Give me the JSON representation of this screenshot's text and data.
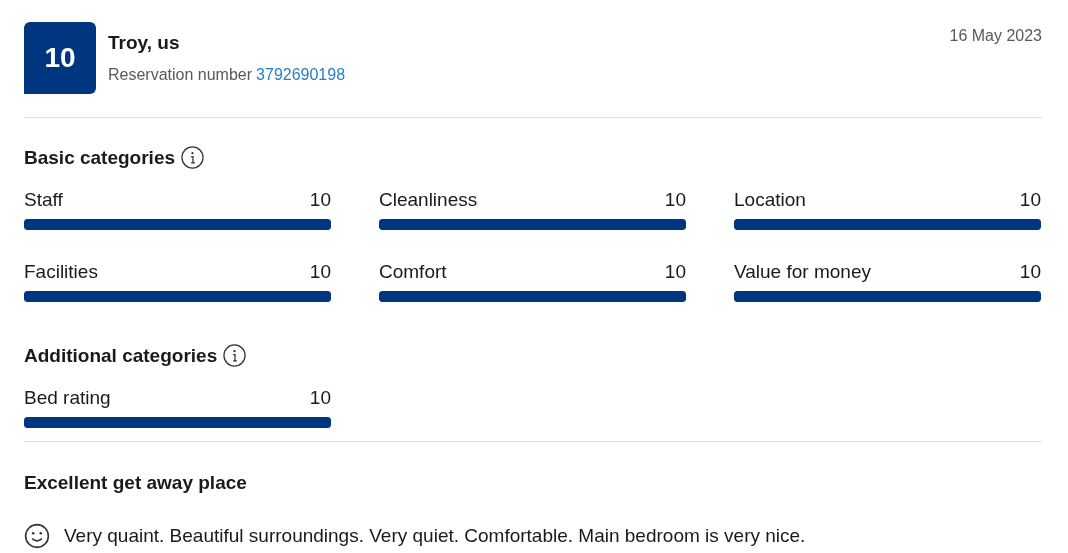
{
  "score": "10",
  "reviewer": {
    "name": "Troy, us",
    "reservation_label": "Reservation number",
    "reservation_number": "3792690198"
  },
  "date": "16 May 2023",
  "sections": [
    {
      "title": "Basic categories",
      "categories": [
        {
          "label": "Staff",
          "score": "10",
          "level": 1
        },
        {
          "label": "Cleanliness",
          "score": "10",
          "level": 1
        },
        {
          "label": "Location",
          "score": "10",
          "level": 1
        },
        {
          "label": "Facilities",
          "score": "10",
          "level": 1
        },
        {
          "label": "Comfort",
          "score": "10",
          "level": 1
        },
        {
          "label": "Value for money",
          "score": "10",
          "level": 1
        }
      ]
    },
    {
      "title": "Additional categories",
      "categories": [
        {
          "label": "Bed rating",
          "score": "10",
          "level": 1
        }
      ]
    }
  ],
  "review": {
    "title": "Excellent get away place",
    "positive": "Very quaint. Beautiful surroundings. Very quiet. Comfortable. Main bedroom is very nice."
  }
}
